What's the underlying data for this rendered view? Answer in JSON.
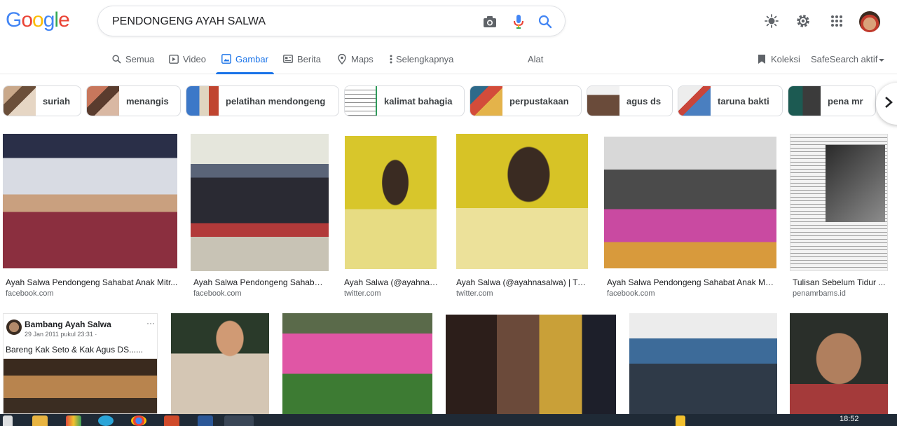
{
  "header": {
    "logo_letters": [
      {
        "ch": "G",
        "color": "#4285F4"
      },
      {
        "ch": "o",
        "color": "#EA4335"
      },
      {
        "ch": "o",
        "color": "#FBBC05"
      },
      {
        "ch": "g",
        "color": "#4285F4"
      },
      {
        "ch": "l",
        "color": "#34A853"
      },
      {
        "ch": "e",
        "color": "#EA4335"
      }
    ],
    "search_query": "PENDONGENG AYAH SALWA",
    "icons": [
      "camera-icon",
      "mic-icon",
      "search-icon",
      "brightness-icon",
      "gear-icon",
      "apps-grid-icon"
    ]
  },
  "tabs": [
    {
      "label": "Semua",
      "icon": "search-icon",
      "active": false
    },
    {
      "label": "Video",
      "icon": "video-icon",
      "active": false
    },
    {
      "label": "Gambar",
      "icon": "image-icon",
      "active": true
    },
    {
      "label": "Berita",
      "icon": "news-icon",
      "active": false
    },
    {
      "label": "Maps",
      "icon": "map-pin-icon",
      "active": false
    },
    {
      "label": "Selengkapnya",
      "icon": "more-vert-icon",
      "active": false
    }
  ],
  "tools_label": "Alat",
  "collections_label": "Koleksi",
  "safesearch_label": "SafeSearch aktif",
  "chips": [
    {
      "label": "suriah"
    },
    {
      "label": "menangis"
    },
    {
      "label": "pelatihan mendongeng"
    },
    {
      "label": "kalimat bahagia"
    },
    {
      "label": "perpustakaan"
    },
    {
      "label": "agus ds"
    },
    {
      "label": "taruna bakti"
    },
    {
      "label": "pena mr"
    }
  ],
  "results_row1": [
    {
      "title": "Ayah Salwa Pendongeng Sahabat Anak Mitr...",
      "source": "facebook.com"
    },
    {
      "title": "Ayah Salwa Pendongeng Sahabat...",
      "source": "facebook.com"
    },
    {
      "title": "Ayah Salwa (@ayahnas...",
      "source": "twitter.com"
    },
    {
      "title": "Ayah Salwa (@ayahnasalwa) | Twi...",
      "source": "twitter.com"
    },
    {
      "title": "Ayah Salwa Pendongeng Sahabat Anak Mit...",
      "source": "facebook.com"
    },
    {
      "title": "Tulisan Sebelum Tidur ...",
      "source": "penamrbams.id"
    }
  ],
  "results_row2_fb_card": {
    "name": "Bambang Ayah Salwa",
    "date": "29 Jan 2011 pukul 23:31 ·",
    "text": "Bareng Kak Seto & Kak Agus DS......",
    "more": "···"
  },
  "taskbar": {
    "time": "18:52"
  }
}
